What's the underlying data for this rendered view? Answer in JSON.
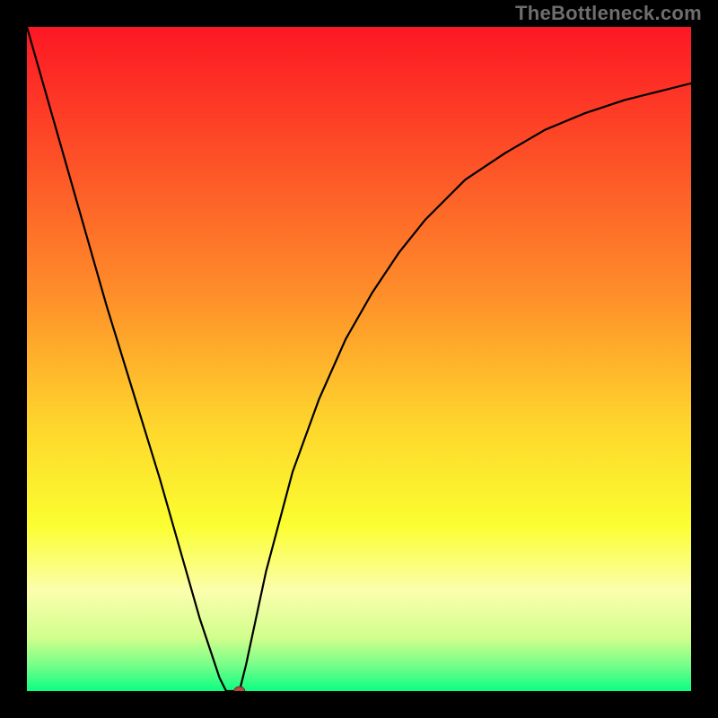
{
  "watermark": {
    "text": "TheBottleneck.com"
  },
  "chart_data": {
    "type": "line",
    "title": "",
    "xlabel": "",
    "ylabel": "",
    "xlim": [
      0,
      100
    ],
    "ylim": [
      0,
      100
    ],
    "background_gradient": {
      "stops": [
        {
          "offset": 0.0,
          "color": "#fd1724"
        },
        {
          "offset": 0.2,
          "color": "#fd5127"
        },
        {
          "offset": 0.4,
          "color": "#fe8d2a"
        },
        {
          "offset": 0.6,
          "color": "#fed62c"
        },
        {
          "offset": 0.75,
          "color": "#fbfe30"
        },
        {
          "offset": 0.85,
          "color": "#fbfead"
        },
        {
          "offset": 0.92,
          "color": "#d1fe8c"
        },
        {
          "offset": 0.96,
          "color": "#79fe89"
        },
        {
          "offset": 1.0,
          "color": "#0cfe82"
        }
      ]
    },
    "series": [
      {
        "name": "bottleneck-curve",
        "color": "#000000",
        "stroke_width": 2.2,
        "x": [
          0,
          4,
          8,
          12,
          16,
          20,
          24,
          26,
          28,
          29,
          30,
          30,
          32,
          32,
          33,
          36,
          40,
          44,
          48,
          52,
          56,
          60,
          66,
          72,
          78,
          84,
          90,
          96,
          100
        ],
        "y": [
          100,
          86,
          72,
          58,
          45,
          32,
          18,
          11,
          5,
          2,
          0,
          0,
          0,
          0,
          4,
          18,
          33,
          44,
          53,
          60,
          66,
          71,
          77,
          81,
          84.5,
          87,
          89,
          90.5,
          91.5
        ]
      }
    ],
    "marker": {
      "name": "current-point",
      "x": 32,
      "y": 0,
      "rx": 6,
      "ry": 5,
      "fill": "#b6483f",
      "stroke": "#6e2b25"
    }
  }
}
